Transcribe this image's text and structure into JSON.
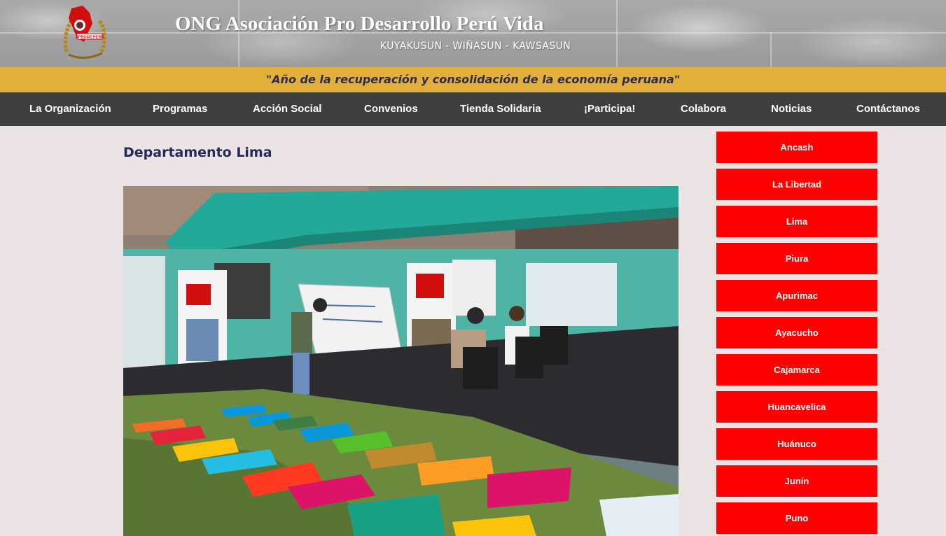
{
  "header": {
    "title": "ONG Asociación Pro Desarrollo Perú Vida",
    "subtitle": "KUYAKUSUN - WIÑASUN - KAWSASUN",
    "logo_text": "APRODE PERÚ"
  },
  "banner": {
    "text": "\"Año de la recuperación y consolidación de la economía peruana\""
  },
  "nav": {
    "items": [
      {
        "label": "La Organización"
      },
      {
        "label": "Programas"
      },
      {
        "label": "Acción Social"
      },
      {
        "label": "Convenios"
      },
      {
        "label": "Tienda Solidaria"
      },
      {
        "label": "¡Participa!"
      },
      {
        "label": "Colabora"
      },
      {
        "label": "Noticias"
      },
      {
        "label": "Contáctanos"
      }
    ]
  },
  "main": {
    "heading": "Departamento Lima"
  },
  "sidebar": {
    "items": [
      {
        "label": "Ancash"
      },
      {
        "label": "La Libertad"
      },
      {
        "label": "Lima"
      },
      {
        "label": "Piura"
      },
      {
        "label": "Apurimac"
      },
      {
        "label": "Ayacucho"
      },
      {
        "label": "Cajamarca"
      },
      {
        "label": "Huancavelica"
      },
      {
        "label": "Huánuco"
      },
      {
        "label": "Junín"
      },
      {
        "label": "Puno"
      }
    ]
  },
  "colors": {
    "banner": "#e2b03a",
    "nav": "#3f3f3f",
    "sidebar_button": "#ff0000",
    "heading": "#232a5e",
    "page_bg": "#ebe3e4"
  }
}
